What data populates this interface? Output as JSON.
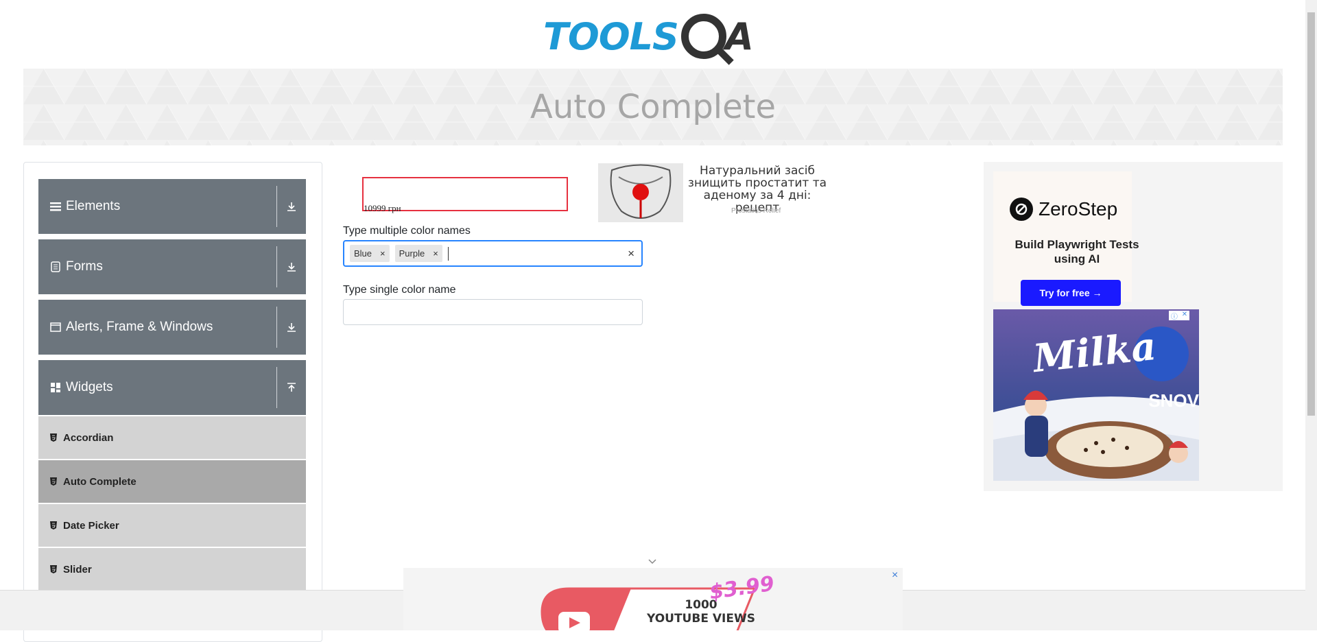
{
  "header": {
    "logo_part1": "TOOLS",
    "logo_part2": "A"
  },
  "banner": {
    "title": "Auto Complete"
  },
  "sidebar": {
    "groups": [
      {
        "label": "Elements",
        "icon": "hamburger-icon"
      },
      {
        "label": "Forms",
        "icon": "document-icon"
      },
      {
        "label": "Alerts, Frame & Windows",
        "icon": "window-icon"
      },
      {
        "label": "Widgets",
        "icon": "grid-icon"
      }
    ],
    "items": [
      {
        "label": "Accordian"
      },
      {
        "label": "Auto Complete"
      },
      {
        "label": "Date Picker"
      },
      {
        "label": "Slider"
      }
    ]
  },
  "ad_middle": {
    "price": "10999 грн",
    "text": "Натуральний засіб знищить простатит та аденому за 4 дні: рецепт",
    "sponsor": "Prostatitis Relief"
  },
  "form": {
    "multi_label": "Type multiple color names",
    "chips": [
      {
        "label": "Blue",
        "remove": "×"
      },
      {
        "label": "Purple",
        "remove": "×"
      }
    ],
    "clear": "×",
    "single_label": "Type single color name",
    "single_value": ""
  },
  "ad_right": {
    "brand": "ZeroStep",
    "subtitle": "Build Playwright Tests using AI",
    "button": "Try for free →",
    "milka_brand": "Milka",
    "milka_snow": "SNOV",
    "milka_oreo": "O"
  },
  "ad_bottom": {
    "line1": "1000",
    "line2": "YOUTUBE VIEWS",
    "price": "$3.99",
    "close": "×"
  }
}
